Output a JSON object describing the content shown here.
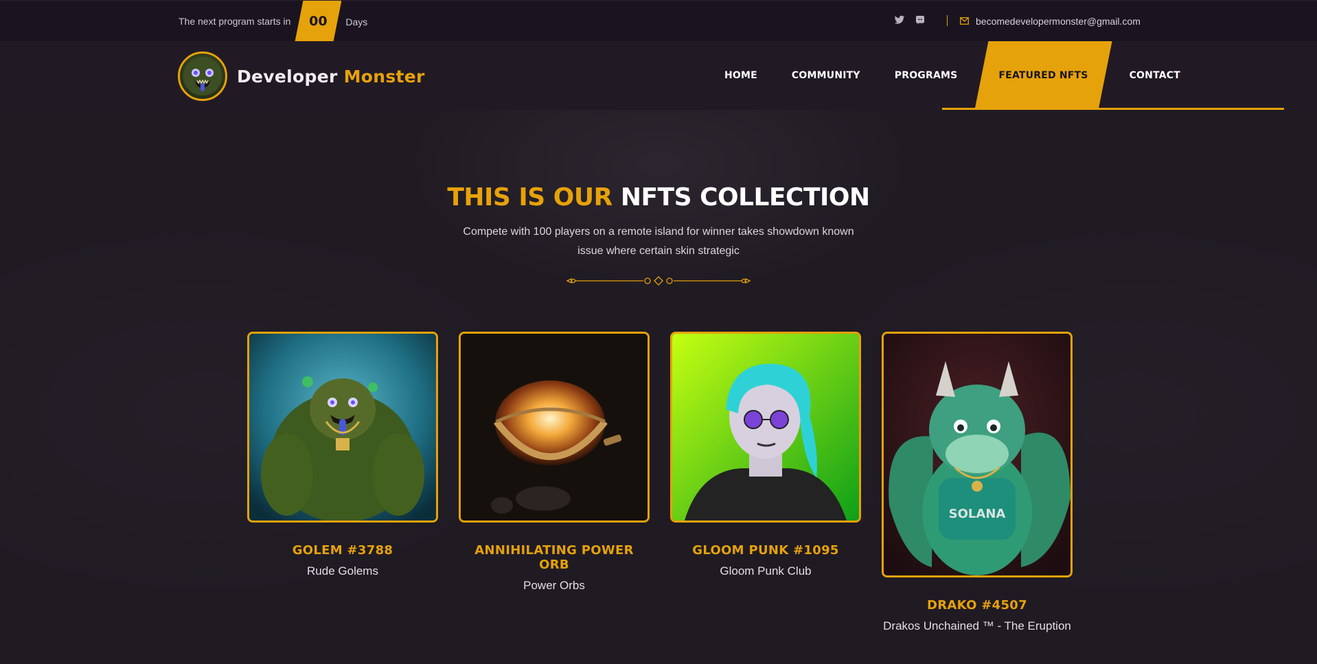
{
  "topbar": {
    "countdown_label": "The next program starts in",
    "countdown_value": "00",
    "countdown_unit": "Days",
    "email": "becomedevelopermonster@gmail.com"
  },
  "brand": {
    "name_part1": "Developer",
    "name_part2": "Monster",
    "accent_color": "#e6a20a"
  },
  "nav": {
    "items": [
      {
        "label": "HOME",
        "active": false
      },
      {
        "label": "COMMUNITY",
        "active": false
      },
      {
        "label": "PROGRAMS",
        "active": false
      },
      {
        "label": "FEATURED NFTS",
        "active": true
      },
      {
        "label": "CONTACT",
        "active": false
      }
    ]
  },
  "section": {
    "title_highlight": "THIS IS OUR",
    "title_rest": "NFTS COLLECTION",
    "subtitle": "Compete with 100 players on a remote island for winner takes showdown known issue where certain skin strategic"
  },
  "nfts": [
    {
      "name": "GOLEM #3788",
      "collection": "Rude Golems",
      "image": "golem-image"
    },
    {
      "name": "ANNIHILATING POWER ORB",
      "collection": "Power Orbs",
      "image": "power-orb-image"
    },
    {
      "name": "GLOOM PUNK #1095",
      "collection": "Gloom Punk Club",
      "image": "gloom-punk-image"
    },
    {
      "name": "DRAKO #4507",
      "collection": "Drakos Unchained ™ - The Eruption",
      "image": "drako-image"
    }
  ]
}
